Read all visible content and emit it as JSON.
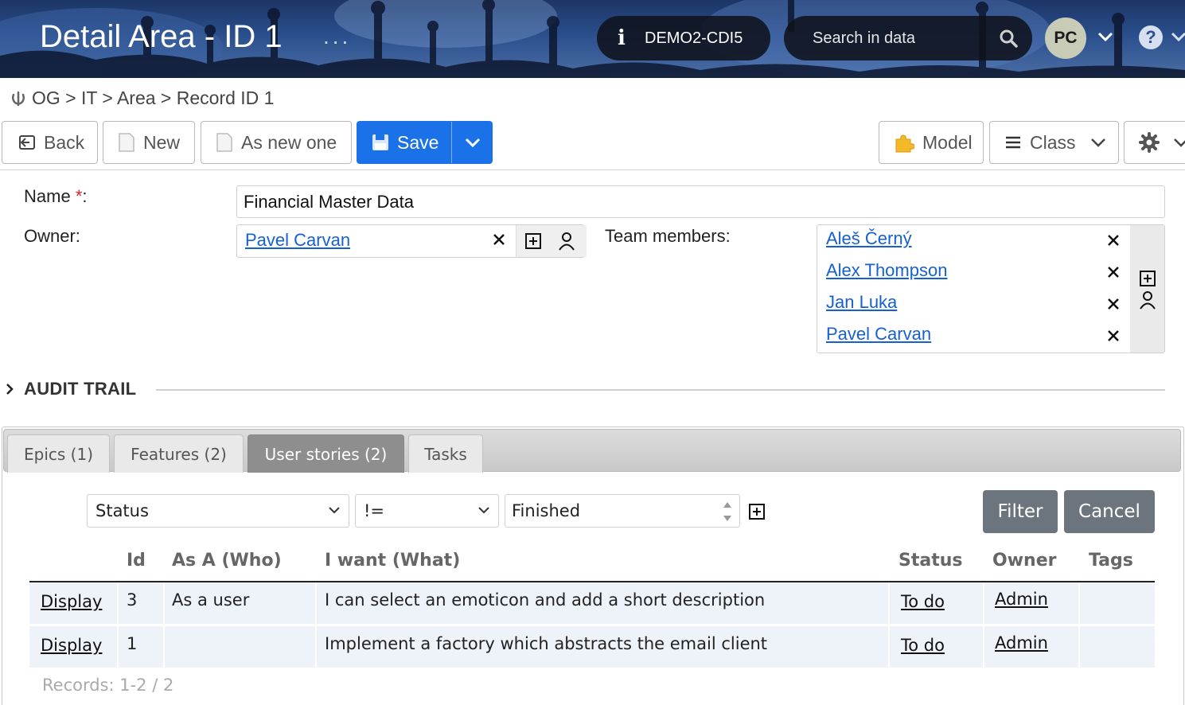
{
  "header": {
    "title": "Detail Area - ID 1",
    "dots": "...",
    "environment": "DEMO2-CDI5",
    "search_placeholder": "Search in data",
    "user_initials": "PC",
    "help": "?"
  },
  "breadcrumb": {
    "text": "OG > IT > Area > Record ID 1"
  },
  "toolbar": {
    "back": "Back",
    "new": "New",
    "as_new_one": "As new one",
    "save": "Save",
    "model": "Model",
    "class": "Class"
  },
  "form": {
    "name_label": "Name",
    "name_required_mark": "*",
    "name_colon": ":",
    "name_value": "Financial Master Data",
    "owner_label": "Owner:",
    "owner_value": "Pavel Carvan",
    "team_label": "Team members:",
    "team_members": [
      "Aleš Černý",
      "Alex Thompson",
      "Jan Luka",
      "Pavel Carvan"
    ]
  },
  "audit_trail": {
    "title": "AUDIT TRAIL"
  },
  "tabs": [
    {
      "label": "Epics (1)"
    },
    {
      "label": "Features (2)"
    },
    {
      "label": "User stories (2)",
      "active": true
    },
    {
      "label": "Tasks"
    }
  ],
  "filter": {
    "field": "Status",
    "operator": "!=",
    "value": "Finished",
    "filter_button": "Filter",
    "cancel_button": "Cancel"
  },
  "table": {
    "columns": [
      "Id",
      "As A (Who)",
      "I want (What)",
      "Status",
      "Owner",
      "Tags"
    ],
    "rows": [
      {
        "action": "Display",
        "id": "3",
        "who": "As a user",
        "what": "I can select an emoticon and add a short description",
        "status": "To do",
        "owner": "Admin",
        "tags": ""
      },
      {
        "action": "Display",
        "id": "1",
        "who": "",
        "what": "Implement a factory which abstracts the email client",
        "status": "To do",
        "owner": "Admin",
        "tags": ""
      }
    ],
    "records": "Records: 1-2 / 2"
  },
  "colors": {
    "save_blue": "#1b72e8",
    "link_blue": "#1660d6",
    "active_tab": "#8e8e8e",
    "filter_button": "#6c757d",
    "row_background": "#eef2f9"
  }
}
